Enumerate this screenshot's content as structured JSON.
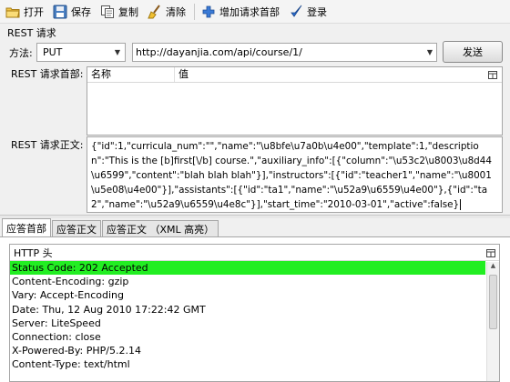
{
  "toolbar": {
    "open": "打开",
    "save": "保存",
    "copy": "复制",
    "clear": "清除",
    "add_header": "增加请求首部",
    "login": "登录"
  },
  "request": {
    "section_title": "REST 请求",
    "method_label": "方法:",
    "method_value": "PUT",
    "url_value": "http://dayanjia.com/api/course/1/",
    "send_label": "发送",
    "headers_label": "REST 请求首部:",
    "headers_columns": [
      "名称",
      "值"
    ],
    "body_label": "REST 请求正文:",
    "body_value": "{\"id\":1,\"curricula_num\":\"\",\"name\":\"\\u8bfe\\u7a0b\\u4e00\",\"template\":1,\"description\":\"This is the [b]first[\\/b] course.\",\"auxiliary_info\":[{\"column\":\"\\u53c2\\u8003\\u8d44\\u6599\",\"content\":\"blah blah blah\"}],\"instructors\":[{\"id\":\"teacher1\",\"name\":\"\\u8001\\u5e08\\u4e00\"}],\"assistants\":[{\"id\":\"ta1\",\"name\":\"\\u52a9\\u6559\\u4e00\"},{\"id\":\"ta2\",\"name\":\"\\u52a9\\u6559\\u4e8c\"}],\"start_time\":\"2010-03-01\",\"active\":false}"
  },
  "response": {
    "tabs": [
      "应答首部",
      "应答正文",
      "应答正文 （XML 高亮）"
    ],
    "headers_title": "HTTP 头",
    "rows": [
      "Status Code: 202 Accepted",
      "Content-Encoding: gzip",
      "Vary: Accept-Encoding",
      "Date: Thu, 12 Aug 2010 17:22:42 GMT",
      "Server: LiteSpeed",
      "Connection: close",
      "X-Powered-By: PHP/5.2.14",
      "Content-Type: text/html"
    ],
    "status_color": "#22ee22"
  }
}
